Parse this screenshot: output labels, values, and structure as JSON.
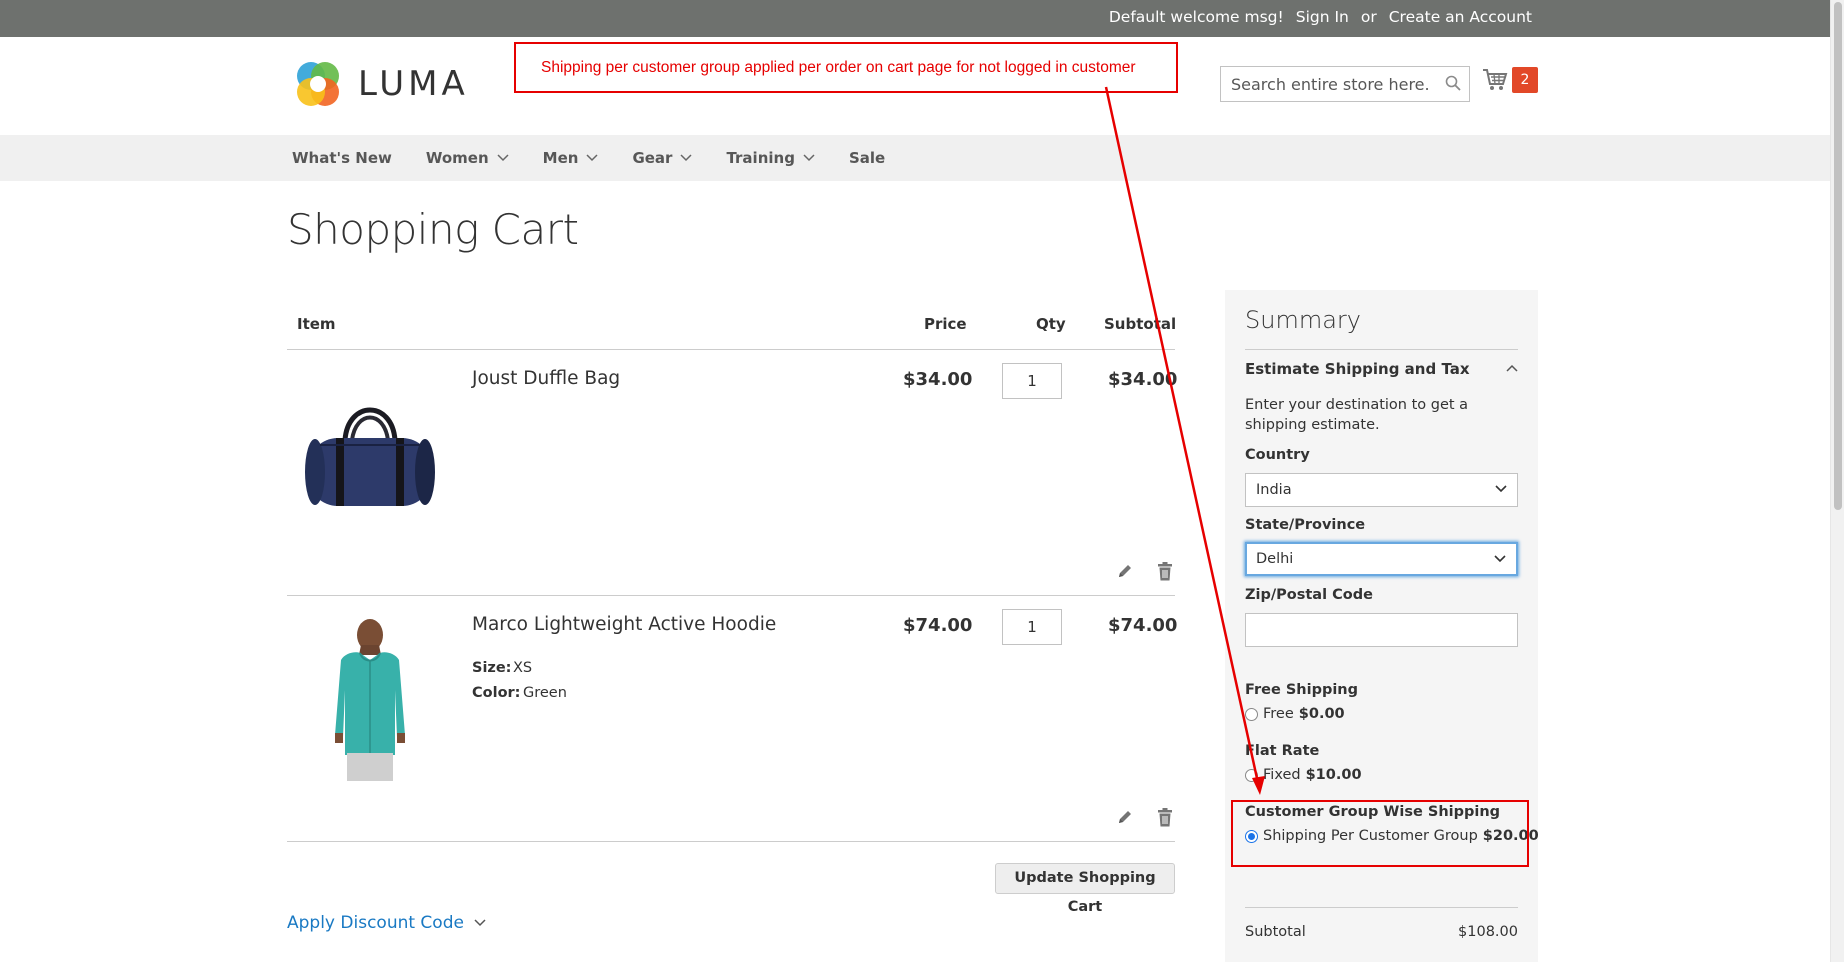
{
  "topbar": {
    "welcome": "Default welcome msg!",
    "sign_in": "Sign In",
    "or": "or",
    "create_account": "Create an Account"
  },
  "header": {
    "logo_text": "LUMA",
    "search_placeholder": "Search entire store here...",
    "cart_count": "2"
  },
  "nav": {
    "items": [
      {
        "label": "What's New",
        "has_dropdown": false
      },
      {
        "label": "Women",
        "has_dropdown": true
      },
      {
        "label": "Men",
        "has_dropdown": true
      },
      {
        "label": "Gear",
        "has_dropdown": true
      },
      {
        "label": "Training",
        "has_dropdown": true
      },
      {
        "label": "Sale",
        "has_dropdown": false
      }
    ]
  },
  "page": {
    "title": "Shopping Cart"
  },
  "cart_table": {
    "headers": {
      "item": "Item",
      "price": "Price",
      "qty": "Qty",
      "subtotal": "Subtotal"
    },
    "items": [
      {
        "name": "Joust Duffle Bag",
        "price": "$34.00",
        "qty": "1",
        "subtotal": "$34.00",
        "options": []
      },
      {
        "name": "Marco Lightweight Active Hoodie",
        "price": "$74.00",
        "qty": "1",
        "subtotal": "$74.00",
        "options": [
          {
            "label": "Size:",
            "value": "XS"
          },
          {
            "label": "Color:",
            "value": "Green"
          }
        ]
      }
    ],
    "update_button": "Update Shopping Cart",
    "discount_link": "Apply Discount Code"
  },
  "summary": {
    "title": "Summary",
    "estimate_title": "Estimate Shipping and Tax",
    "estimate_text": "Enter your destination to get a shipping estimate.",
    "country_label": "Country",
    "country_value": "India",
    "state_label": "State/Province",
    "state_value": "Delhi",
    "zip_label": "Zip/Postal Code",
    "zip_value": "",
    "methods": [
      {
        "group": "Free Shipping",
        "option": "Free",
        "amount": "$0.00",
        "checked": false
      },
      {
        "group": "Flat Rate",
        "option": "Fixed",
        "amount": "$10.00",
        "checked": false
      },
      {
        "group": "Customer Group Wise Shipping",
        "option": "Shipping Per Customer Group",
        "amount": "$20.00",
        "checked": true
      }
    ],
    "subtotal_label": "Subtotal",
    "subtotal_value": "$108.00"
  },
  "annotation": {
    "text": "Shipping per customer group applied per order on cart page for not logged in customer",
    "color": "#e60000"
  },
  "colors": {
    "topbar_bg": "#6e716e",
    "nav_bg": "#f0f0f0",
    "cart_badge": "#e24828",
    "link_blue": "#1979c3"
  }
}
